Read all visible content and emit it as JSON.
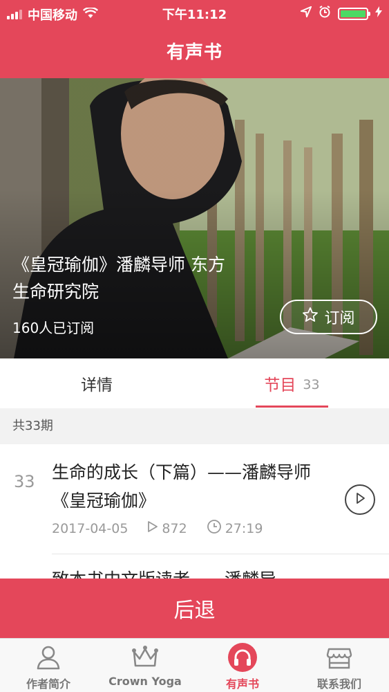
{
  "status_bar": {
    "carrier": "中国移动",
    "time": "下午11:12"
  },
  "nav": {
    "title": "有声书"
  },
  "hero": {
    "title": "《皇冠瑜伽》潘麟导师 东方生命研究院",
    "subscribers": "160人已订阅",
    "subscribe_label": "订阅"
  },
  "tabs": {
    "detail": "详情",
    "episodes": "节目",
    "episodes_count": "33"
  },
  "list": {
    "total_label": "共33期",
    "episodes": [
      {
        "index": "33",
        "title": "生命的成长（下篇）——潘麟导师《皇冠瑜伽》",
        "date": "2017-04-05",
        "plays": "872",
        "duration": "27:19"
      },
      {
        "title": "致本书中文版读者——潘麟导"
      }
    ]
  },
  "back_button": "后退",
  "tabbar": {
    "items": [
      {
        "label": "作者简介",
        "icon": "person-icon"
      },
      {
        "label": "Crown Yoga",
        "icon": "crown-icon"
      },
      {
        "label": "有声书",
        "icon": "headphones-icon"
      },
      {
        "label": "联系我们",
        "icon": "store-icon"
      }
    ],
    "active_color": "#e4475a"
  },
  "colors": {
    "accent": "#e4475a",
    "battery": "#4cd964"
  }
}
